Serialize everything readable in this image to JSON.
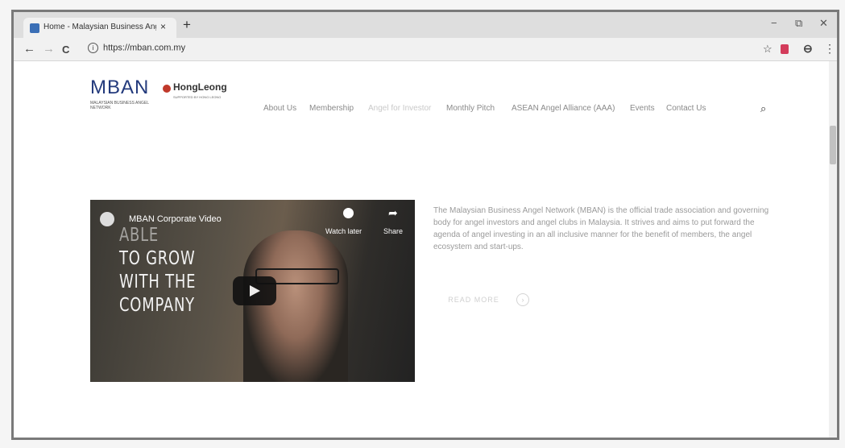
{
  "browser": {
    "tab_title": "Home - Malaysian Business Ang",
    "tab_close": "×",
    "new_tab": "+",
    "back": "←",
    "forward": "→",
    "reload": "C",
    "info": "i",
    "url": "https://mban.com.my",
    "star": "☆",
    "account": "⊖",
    "menu": "⋮",
    "minimize": "−",
    "restore": "⧉",
    "close": "✕"
  },
  "logo": {
    "mban": "MBAN",
    "partner": "HongLeong",
    "subtitle": "MALAYSIAN BUSINESS ANGEL NETWORK",
    "partner_sub": "SUPPORTED BY HONG LEONG"
  },
  "nav": {
    "items": [
      "About Us",
      "Membership",
      "Angel for Investor",
      "Monthly Pitch",
      "ASEAN Angel Alliance (AAA)",
      "Events",
      "Contact Us"
    ],
    "search_icon": "⌕"
  },
  "video": {
    "title": "MBAN Corporate Video",
    "overlay_lines": [
      "ABLE",
      "TO GROW",
      "WITH THE",
      "COMPANY"
    ],
    "watch_later": "Watch later",
    "share": "Share",
    "share_glyph": "➦"
  },
  "intro": {
    "text": "The Malaysian Business Angel Network (MBAN) is the official trade association and governing body for angel investors and angel clubs in Malaysia. It strives and aims to put forward the agenda of angel investing in an all inclusive manner for the benefit of members, the angel ecosystem and start-ups.",
    "read_more": "READ MORE",
    "read_more_arrow": "›"
  },
  "colors": {
    "brand": "#233a7c",
    "nav_text": "#8a8a8a",
    "body_text": "#9a9a9a"
  }
}
